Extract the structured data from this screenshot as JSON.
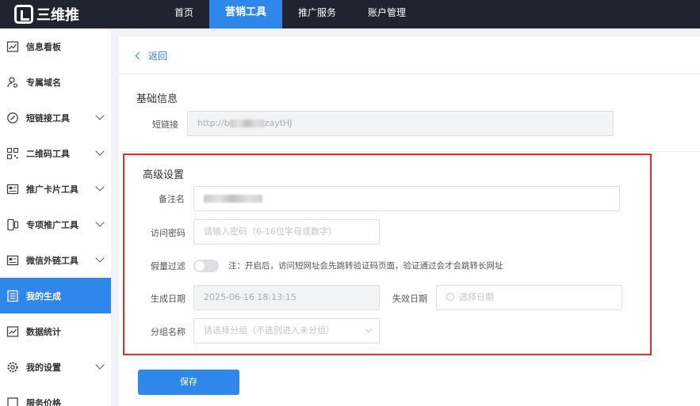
{
  "app": {
    "logo_text": "三维推"
  },
  "nav": [
    {
      "label": "首页"
    },
    {
      "label": "营销工具"
    },
    {
      "label": "推广服务"
    },
    {
      "label": "账户管理"
    }
  ],
  "sidebar": {
    "items": [
      {
        "label": "信息看板",
        "icon": "chart-icon"
      },
      {
        "label": "专属域名",
        "icon": "user-link-icon"
      },
      {
        "label": "短链接工具",
        "icon": "link-icon"
      },
      {
        "label": "二维码工具",
        "icon": "qrcode-icon"
      },
      {
        "label": "推广卡片工具",
        "icon": "card-icon"
      },
      {
        "label": "专项推广工具",
        "icon": "phone-icon"
      },
      {
        "label": "微信外链工具",
        "icon": "wechat-link-icon"
      },
      {
        "label": "我的生成",
        "icon": "list-icon"
      },
      {
        "label": "数据统计",
        "icon": "stats-icon"
      },
      {
        "label": "我的设置",
        "icon": "gear-icon"
      },
      {
        "label": "服务价格",
        "icon": "price-icon"
      }
    ]
  },
  "content": {
    "back_label": "返回",
    "basic": {
      "title": "基础信息",
      "short_link_label": "短链接",
      "short_link_value_start": "http://b",
      "short_link_value_end": "zaytHJ"
    },
    "advanced": {
      "title": "高级设置",
      "remark_label": "备注名",
      "password_label": "访问密码",
      "password_placeholder": "请输入密码（6-16位字母或数字）",
      "filter_label": "假量过滤",
      "filter_note": "注：开启后，访问短网址会先跳转验证码页面，验证通过会才会跳转长网址",
      "created_label": "生成日期",
      "created_value": "2025-06-16 18:13:15",
      "expire_label": "失效日期",
      "expire_placeholder": "选择日期",
      "group_label": "分组名称",
      "group_placeholder": "请选择分组（不选则进入未分组）"
    },
    "save_label": "保存"
  },
  "colors": {
    "accent": "#2f86eb",
    "topbar": "#1f2430",
    "highlight_box": "#e0302d"
  }
}
